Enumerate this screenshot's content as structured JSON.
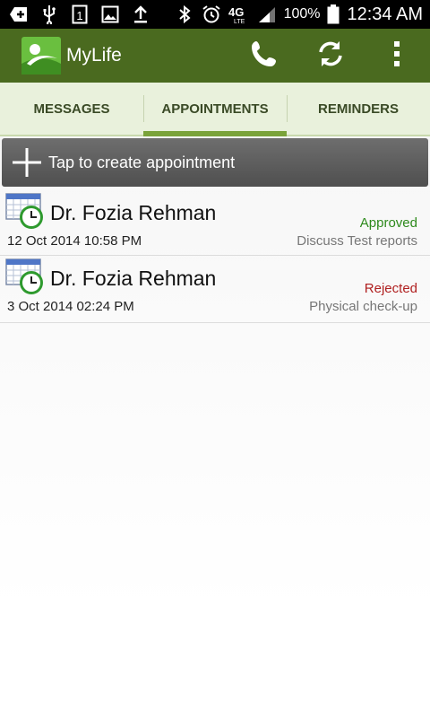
{
  "status_bar": {
    "battery": "100%",
    "time": "12:34 AM",
    "network": "4G"
  },
  "app": {
    "title": "MyLife",
    "accent": "#4a6a1f"
  },
  "tabs": [
    {
      "label": "MESSAGES"
    },
    {
      "label": "APPOINTMENTS"
    },
    {
      "label": "REMINDERS"
    }
  ],
  "create": {
    "label": "Tap to create appointment"
  },
  "appointments": [
    {
      "doctor": "Dr. Fozia Rehman",
      "datetime": "12 Oct 2014 10:58 PM",
      "status": "Approved",
      "status_color": "#2d8a1c",
      "reason": "Discuss Test reports"
    },
    {
      "doctor": "Dr. Fozia Rehman",
      "datetime": "3 Oct 2014 02:24 PM",
      "status": "Rejected",
      "status_color": "#b02020",
      "reason": "Physical check-up"
    }
  ],
  "icons": {
    "phone": "phone-icon",
    "refresh": "refresh-icon",
    "overflow": "overflow-menu-icon",
    "add": "plus-icon",
    "appointment": "calendar-clock-icon"
  }
}
